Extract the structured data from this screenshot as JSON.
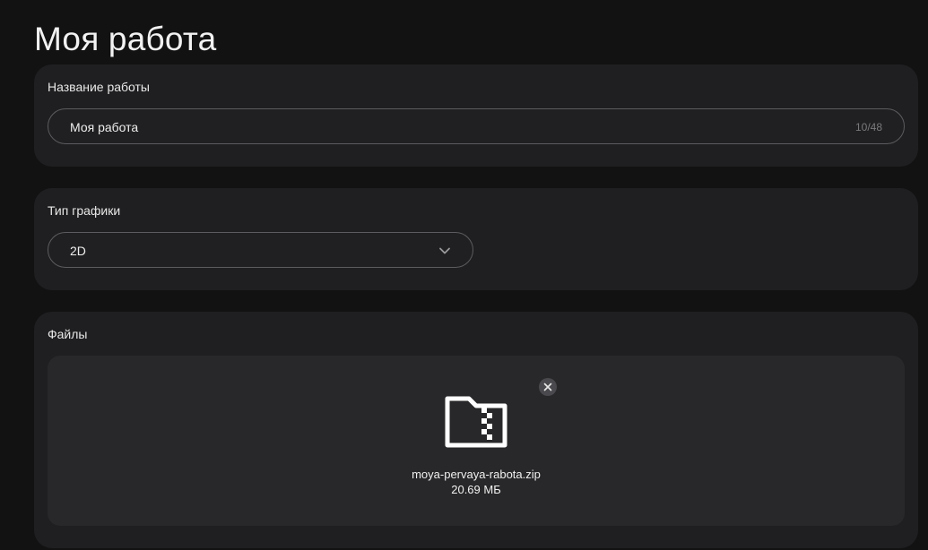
{
  "page": {
    "title": "Моя работа"
  },
  "work_name": {
    "label": "Название работы",
    "value": "Моя работа",
    "counter": "10/48"
  },
  "graphics_type": {
    "label": "Тип графики",
    "selected": "2D",
    "icon": "chevron-down-icon"
  },
  "files": {
    "label": "Файлы",
    "items": [
      {
        "name": "moya-pervaya-rabota.zip",
        "size": "20.69 МБ",
        "icon": "zip-folder-icon",
        "remove_icon": "close-icon"
      }
    ]
  },
  "colors": {
    "background": "#121213",
    "card": "#1f1f21",
    "dropzone": "#28282a",
    "border": "#5c5c60",
    "text": "#ececec",
    "muted": "#7a7a7e"
  }
}
